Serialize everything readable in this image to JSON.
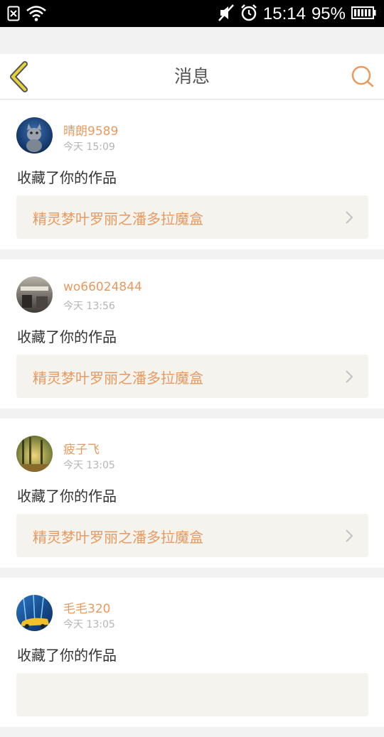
{
  "status_bar": {
    "time": "15:14",
    "battery": "95%",
    "icons": [
      "sim-off-icon",
      "wifi-icon",
      "mute-icon",
      "alarm-icon",
      "battery-icon"
    ]
  },
  "header": {
    "title": "消息",
    "back_icon": "chevron-left-icon",
    "search_icon": "search-icon"
  },
  "colors": {
    "accent": "#e79a60",
    "back_arrow": "#e6d33a",
    "link_bg": "#f4f3ee"
  },
  "messages": [
    {
      "username": "晴朗9589",
      "time": "今天 15:09",
      "action": "收藏了你的作品",
      "work": "精灵梦叶罗丽之潘多拉魔盒"
    },
    {
      "username": "wo66024844",
      "time": "今天 13:56",
      "action": "收藏了你的作品",
      "work": "精灵梦叶罗丽之潘多拉魔盒"
    },
    {
      "username": "疲子飞",
      "time": "今天 13:05",
      "action": "收藏了你的作品",
      "work": "精灵梦叶罗丽之潘多拉魔盒"
    },
    {
      "username": "毛毛320",
      "time": "今天 13:05",
      "action": "收藏了你的作品",
      "work": ""
    }
  ]
}
